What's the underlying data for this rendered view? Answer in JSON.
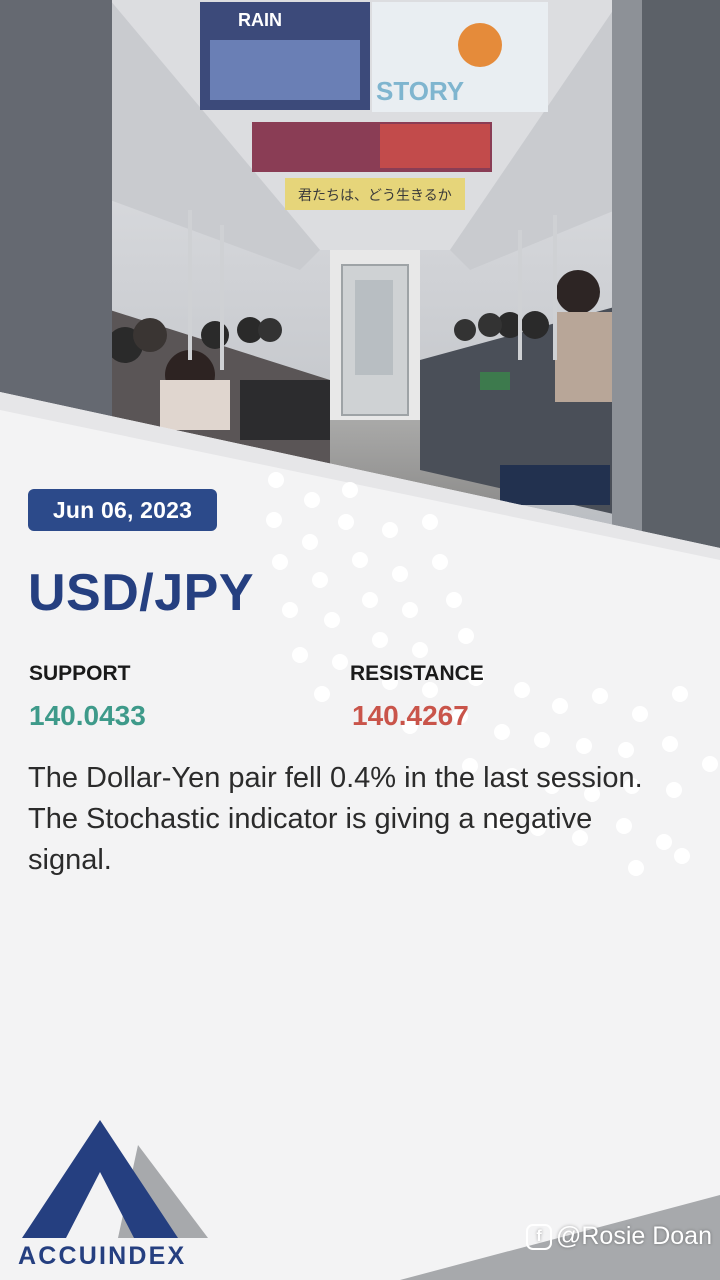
{
  "card": {
    "date": "Jun 06, 2023",
    "pair": "USD/JPY",
    "support_label": "SUPPORT",
    "support_value": "140.0433",
    "resistance_label": "RESISTANCE",
    "resistance_value": "140.4267",
    "description": "The Dollar-Yen pair fell 0.4% in the last session. The Stochastic indicator is giving a negative signal."
  },
  "photo": {
    "subject": "subway-car-interior",
    "sign_text_1": "RAIN",
    "sign_text_2": "STORY",
    "banner_text": "君たちは、どう生きるか"
  },
  "brand": {
    "logo_text": "ACCUINDEX"
  },
  "watermark": {
    "text": "@Rosie Doan"
  },
  "colors": {
    "navy": "#253f80",
    "badge": "#2c4a8a",
    "support": "#3e9a8a",
    "resistance": "#c9544a",
    "background": "#f3f3f4"
  }
}
